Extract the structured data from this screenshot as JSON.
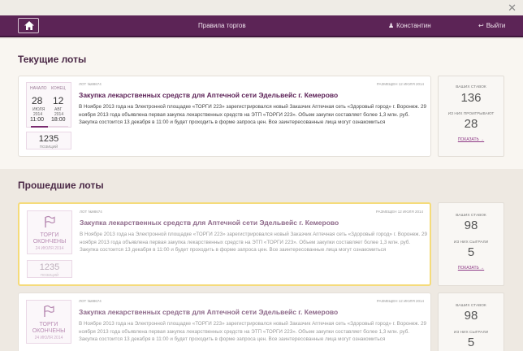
{
  "window": {
    "close_glyph": "✕"
  },
  "header": {
    "rules_label": "Правила торгов",
    "user_name": "Константин",
    "logout_label": "Выйти"
  },
  "current": {
    "title": "Текущие лоты",
    "lot": {
      "lot_no": "ЛОТ №98674",
      "placed": "РАЗМЕЩЕН 12 ИЮЛЯ 2014",
      "title": "Закупка лекарственных средств для Аптечной сети Эдельвейс г. Кемерово",
      "desc": "В Ноябре 2013 года на Электронной площадке «ТОРГИ 223» зарегистрировался новый Заказчик Аптечная сеть «Здоровый город» г. Воронеж. 29 ноября 2013 года объявлена первая закупка лекарственных средств на ЭТП «ТОРГИ 223». Объем закупки составляет более 1,3 млн. руб. Закупка состоится 13 декабря в 11:00 и будет проходить в форме запроса цен. Все заинтересованные лица могут ознакомиться",
      "start": {
        "label": "НАЧАЛО",
        "day": "28",
        "month": "ИЮЛЯ",
        "year": "2014",
        "time": "11:00"
      },
      "end": {
        "label": "КОНЕЦ",
        "day": "12",
        "month": "АВГ",
        "year": "2014",
        "time": "18:00"
      },
      "progress": 0.45,
      "positions": "1235",
      "positions_label": "ПОЗИЦИЙ"
    },
    "stats": {
      "bids_label": "ВАШИХ СТАВОК",
      "bids": "136",
      "lost_label": "ИЗ НИХ ПРОИГРЫВАЮТ",
      "lost": "28",
      "show_label": "ПОКАЗАТЬ →"
    }
  },
  "past": {
    "title": "Прошедшие лоты",
    "lots": [
      {
        "lot_no": "ЛОТ №98674",
        "placed": "РАЗМЕЩЕН 12 ИЮЛЯ 2014",
        "title": "Закупка лекарственных средств для Аптечной сети Эдельвейс г. Кемерово",
        "desc": "В Ноябре 2013 года на Электронной площадке «ТОРГИ 223» зарегистрировался новый Заказчик Аптечная сеть «Здоровый город» г. Воронеж. 29 ноября 2013 года объявлена первая закупка лекарственных средств на ЭТП «ТОРГИ 223». Объем закупки составляет более 1,3 млн. руб. Закупка состоится 13 декабря в 11:00 и будет проходить в форме запроса цен. Все заинтересованные лица могут ознакомиться",
        "ended_label": "ТОРГИ ОКОНЧЕНЫ",
        "ended_date": "24 ИЮЛЯ 2014",
        "positions": "1235",
        "positions_label": "ПОЗИЦИЙ",
        "stats": {
          "bids_label": "ВАШИХ СТАВОК",
          "bids": "98",
          "won_label": "ИЗ НИХ СЫГРАЛИ",
          "won": "5",
          "show_label": "ПОКАЗАТЬ →"
        }
      },
      {
        "lot_no": "ЛОТ №98674",
        "placed": "РАЗМЕЩЕН 12 ИЮЛЯ 2014",
        "title": "Закупка лекарственных средств для Аптечной сети Эдельвейс г. Кемерово",
        "desc": "В Ноябре 2013 года на Электронной площадке «ТОРГИ 223» зарегистрировался новый Заказчик Аптечная сеть «Здоровый город» г. Воронеж. 29 ноября 2013 года объявлена первая закупка лекарственных средств на ЭТП «ТОРГИ 223». Объем закупки составляет более 1,3 млн. руб. Закупка состоится 13 декабря в 11:00 и будет проходить в форме запроса цен. Все заинтересованные лица могут ознакомиться",
        "ended_label": "ТОРГИ ОКОНЧЕНЫ",
        "ended_date": "24 ИЮЛЯ 2014",
        "stats": {
          "bids_label": "ВАШИХ СТАВОК",
          "bids": "98",
          "won_label": "ИЗ НИХ СЫГРАЛИ",
          "won": "5"
        }
      }
    ]
  },
  "colors": {
    "header": "#5c2456",
    "accent": "#8e3a86",
    "highlight_border": "#f5db7a"
  }
}
